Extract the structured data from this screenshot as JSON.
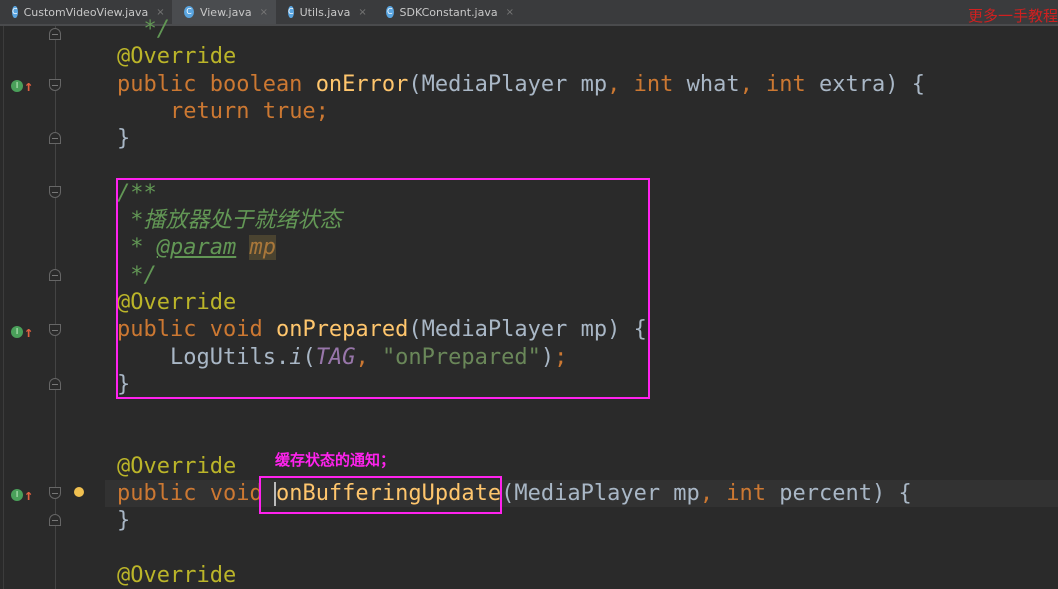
{
  "tabs": [
    {
      "label": "CustomVideoView.java",
      "icon": "class-icon",
      "active": false
    },
    {
      "label": "View.java",
      "icon": "class-icon",
      "active": true
    },
    {
      "label": "Utils.java",
      "icon": "class-icon",
      "active": false
    },
    {
      "label": "SDKConstant.java",
      "icon": "class-icon",
      "active": false
    }
  ],
  "tab_icon_glyph": "C",
  "tab_close_glyph": "×",
  "watermark": "更多一手教程",
  "impl_glyph": "I",
  "impl_arrow": "↑",
  "annotation_note": "缓存状态的通知；",
  "code_lines": [
    [
      [
        "cm",
        "  */"
      ]
    ],
    [
      [
        "ann",
        "@Override"
      ]
    ],
    [
      [
        "kw",
        "public boolean "
      ],
      [
        "fn",
        "onError"
      ],
      [
        "txt",
        "(MediaPlayer mp"
      ],
      [
        "kw",
        ", int "
      ],
      [
        "txt",
        "what"
      ],
      [
        "kw",
        ", int "
      ],
      [
        "txt",
        "extra) {"
      ]
    ],
    [
      [
        "txt",
        "    "
      ],
      [
        "kw",
        "return true;"
      ]
    ],
    [
      [
        "txt",
        "}"
      ]
    ],
    [],
    [
      [
        "cm",
        "/**"
      ]
    ],
    [
      [
        "cm",
        " *播放器处于就绪状态"
      ]
    ],
    [
      [
        "cm",
        " * "
      ],
      [
        "cmtag",
        "@param"
      ],
      [
        "cm",
        " "
      ],
      [
        "phl",
        "mp"
      ]
    ],
    [
      [
        "cm",
        " */"
      ]
    ],
    [
      [
        "ann",
        "@Override"
      ]
    ],
    [
      [
        "kw",
        "public void "
      ],
      [
        "fn",
        "onPrepared"
      ],
      [
        "txt",
        "(MediaPlayer mp) {"
      ]
    ],
    [
      [
        "txt",
        "    LogUtils."
      ],
      [
        "ital",
        "i"
      ],
      [
        "txt",
        "("
      ],
      [
        "const",
        "TAG"
      ],
      [
        "kw",
        ", "
      ],
      [
        "str",
        "\"onPrepared\""
      ],
      [
        "txt",
        ")"
      ],
      [
        "kw",
        ";"
      ]
    ],
    [
      [
        "txt",
        "}"
      ]
    ],
    [],
    [],
    [
      [
        "ann",
        "@Override"
      ]
    ],
    [
      [
        "kw",
        "public void "
      ],
      [
        "fn",
        "onBufferingUpdate"
      ],
      [
        "txt",
        "(MediaPlayer mp"
      ],
      [
        "kw",
        ", int "
      ],
      [
        "txt",
        "percent) {"
      ]
    ],
    [
      [
        "txt",
        "}"
      ]
    ],
    [],
    [
      [
        "ann",
        "@Override"
      ]
    ]
  ]
}
